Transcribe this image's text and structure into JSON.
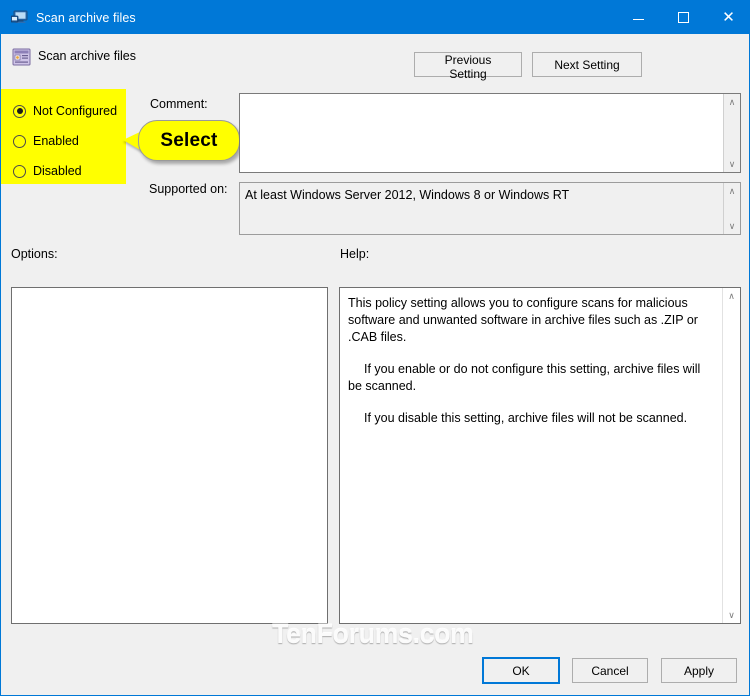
{
  "window": {
    "title": "Scan archive files",
    "title_icon": "policy-setting-icon",
    "controls": {
      "minimize": "minimize-icon",
      "maximize": "maximize-icon",
      "close": "close-icon"
    }
  },
  "header": {
    "policy_icon": "group-policy-setting-icon",
    "policy_name": "Scan archive files",
    "previous_setting": "Previous Setting",
    "next_setting": "Next Setting"
  },
  "state_group": {
    "options": [
      {
        "label": "Not Configured",
        "selected": true
      },
      {
        "label": "Enabled",
        "selected": false
      },
      {
        "label": "Disabled",
        "selected": false
      }
    ],
    "highlight_color": "#ffff00"
  },
  "callout": {
    "text": "Select",
    "fill": "#ffff00",
    "border": "#9a9a9a"
  },
  "comment": {
    "label": "Comment:",
    "value": "",
    "scroll_up": "∧",
    "scroll_down": "∨"
  },
  "supported": {
    "label": "Supported on:",
    "value": "At least Windows Server 2012, Windows 8 or Windows RT",
    "scroll_up": "∧",
    "scroll_down": "∨"
  },
  "options_panel": {
    "label": "Options:",
    "value": ""
  },
  "help_panel": {
    "label": "Help:",
    "paragraphs": [
      "This policy setting allows you to configure scans for malicious software and unwanted software in archive files such as .ZIP or .CAB files.",
      "If you enable or do not configure this setting, archive files will be scanned.",
      "If you disable this setting, archive files will not be scanned."
    ],
    "scroll_up": "∧",
    "scroll_down": "∨"
  },
  "watermark": {
    "text": "TenForums.com"
  },
  "footer": {
    "ok": "OK",
    "cancel": "Cancel",
    "apply": "Apply"
  },
  "colors": {
    "titlebar": "#0078d7",
    "dialog_bg": "#f0f0f0",
    "accent": "#0078d7",
    "highlight": "#ffff00"
  }
}
